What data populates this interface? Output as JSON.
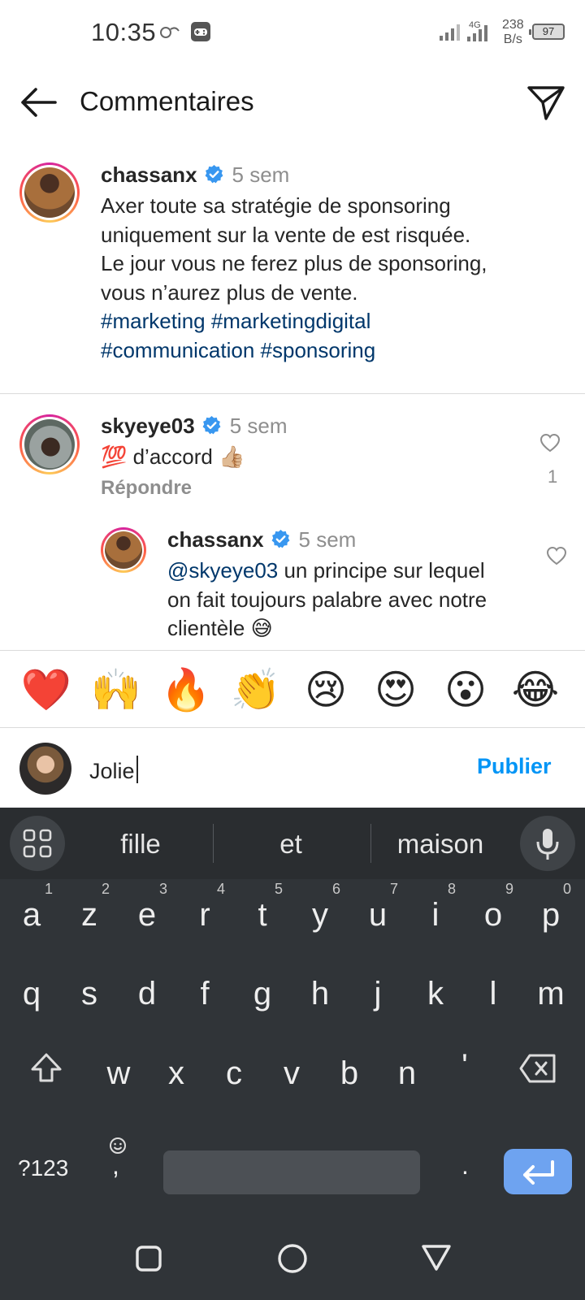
{
  "status_bar": {
    "time": "10:35",
    "network_type": "4G",
    "speed_value": "238",
    "speed_unit": "B/s",
    "battery": "97"
  },
  "header": {
    "title": "Commentaires",
    "back_icon": "arrow-left-icon",
    "send_icon": "paper-plane-icon"
  },
  "caption": {
    "username": "chassanx",
    "time": "5 sem",
    "text_lines": [
      "Axer toute sa stratégie de sponsoring",
      "uniquement sur la vente de est risquée.",
      "Le jour vous ne ferez plus de sponsoring,",
      "vous n’aurez plus de vente."
    ],
    "hashtags_line1": "#marketing #marketingdigital",
    "hashtags_line2": "#communication #sponsoring"
  },
  "comments": [
    {
      "username": "skyeye03",
      "time": "5 sem",
      "text": "💯 d’accord 👍🏼",
      "reply_label": "Répondre",
      "likes": "1"
    }
  ],
  "reply": {
    "username": "chassanx",
    "time": "5 sem",
    "mention": "@skyeye03",
    "text_line1": " un principe sur lequel",
    "text_line2": "on fait toujours palabre avec notre",
    "text_line3": "clientèle 😅"
  },
  "emoji_bar": [
    "❤️",
    "🙌",
    "🔥",
    "👏",
    "😢",
    "😍",
    "😮",
    "😂"
  ],
  "composer": {
    "value": "Jolie",
    "publish_label": "Publier"
  },
  "keyboard": {
    "suggestions": [
      "fille",
      "et",
      "maison"
    ],
    "row1": [
      "a",
      "z",
      "e",
      "r",
      "t",
      "y",
      "u",
      "i",
      "o",
      "p"
    ],
    "row1_numbers": [
      "1",
      "2",
      "3",
      "4",
      "5",
      "6",
      "7",
      "8",
      "9",
      "0"
    ],
    "row2": [
      "q",
      "s",
      "d",
      "f",
      "g",
      "h",
      "j",
      "k",
      "l",
      "m"
    ],
    "row3": [
      "w",
      "x",
      "c",
      "v",
      "b",
      "n",
      "'"
    ],
    "symbols_label": "?123",
    "comma": ",",
    "period": "."
  },
  "colors": {
    "link": "#00376b",
    "accent": "#0095f6",
    "verified": "#3897f0",
    "keyboard_bg": "#303438",
    "enter_key": "#6ea3f0"
  }
}
